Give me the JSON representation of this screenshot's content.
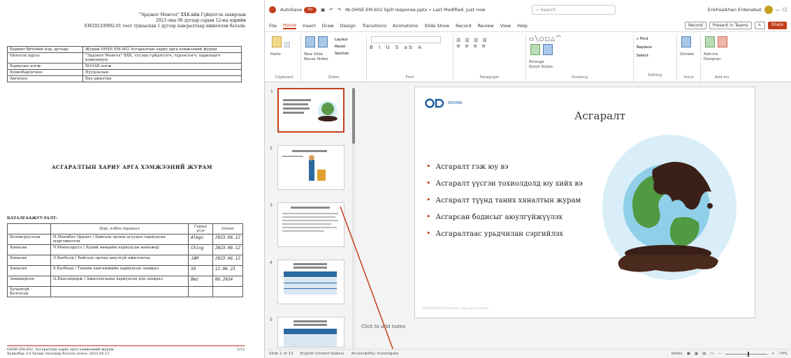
{
  "doc": {
    "header_lines": [
      "\"Эрдэнэт Монгол\" ХХК-ийн Гүйцэтгэх захирлын",
      "2023 оны 06 дугаар сарын 12-ны өдрийн",
      "EM2023/0902-01 тоот тушаалын 1 дүгээр хавсралтаар шинэчлэн баталв."
    ],
    "info_rows": [
      [
        "Баримт бичгийн нэр, дугаар:",
        "Журам OHSE.EM.602 Асгаралтын хариу арга хэмжээний журам"
      ],
      [
        "Үйлчлэх хүрээ:",
        "\"Эрдэнэт Монгол\" ХХК, туслан гүйцэтгэгч, түрээслэгч, харилцагч компаниуд"
      ],
      [
        "Хариуцах нэгж:",
        "БОЭАБ нэгж"
      ],
      [
        "Хувилбар/огноо:",
        "Нууцлалын"
      ],
      [
        "Ангилал:",
        "Бүх ажилтан"
      ]
    ],
    "title": "АСГАРАЛТЫН ХАРИУ АРГА ХЭМЖЭЭНИЙ ЖУРАМ",
    "bat_label": "БАТАЛГААЖУУЛАЛТ:",
    "sig_headers": [
      "",
      "Нэр, албан тушаал",
      "Гарын үсэг",
      "Огноо"
    ],
    "sig_rows": [
      [
        "Боловсруулсан",
        "Н.Мөнхбат-Эрдэнэ / Байгаль орчны асуудал хариуцсан мэргэжилтэн",
        "Alegs",
        "2023.06.12"
      ],
      [
        "Хянасан",
        "Ч.Мөнхсаруул / Хүний нөөцийн хариуцсан менежер",
        "Ching",
        "2023.06.12"
      ],
      [
        "Хянасан",
        "Э.Батболд / Байгаль орчны аюулгүй ажиллагаа",
        "JAM",
        "2023.06.12"
      ],
      [
        "Хянасан",
        "Х.Батбаяр / Техник хангамжийн хариуцсан захирал",
        "XX",
        "12.06.23"
      ],
      [
        "Зөвшөөрсөн",
        "Ц.Баасандорж / Ажиллагааны хариуцсан дэд захирал",
        "Bmz",
        "06.2024"
      ],
      [
        "Хүчингүй болгосон",
        "",
        "",
        ""
      ]
    ],
    "footer_left": "OHSE.EM.602. Асгаралтын хариу арга хэмжээний журам",
    "footer_left2": "Хувилбар 3.0 Хүчин төгөлдөр болсон огноо: 2023.06.12",
    "footer_page": "1/13"
  },
  "app": {
    "autosave_label": "AutoSave",
    "toggle_label": "On",
    "file_name": "IN.OHSE.EM.602 Spill response.pptx • Last Modified: Just now",
    "search_placeholder": "Search",
    "user_name": "Enkhsaikhan Erdenebat",
    "tabs": [
      "File",
      "Home",
      "Insert",
      "Draw",
      "Design",
      "Transitions",
      "Animations",
      "Slide Show",
      "Record",
      "Review",
      "View",
      "Help"
    ],
    "active_tab": "Home",
    "record_label": "Record",
    "present_label": "Present in Teams",
    "share_label": "Share"
  },
  "ribbon": {
    "groups": [
      "Clipboard",
      "Slides",
      "Font",
      "Paragraph",
      "Drawing",
      "Editing",
      "Voice",
      "Add-ins"
    ],
    "paste": "Paste",
    "new_slide": "New Slide",
    "reuse": "Reuse Slides",
    "layout": "Layout",
    "reset": "Reset",
    "section": "Section",
    "arrange": "Arrange",
    "quick_styles": "Quick Styles",
    "find": "Find",
    "replace": "Replace",
    "select": "Select",
    "dictate": "Dictate",
    "addins": "Add-ins",
    "designer": "Designer"
  },
  "thumbs": [
    "1",
    "2",
    "3",
    "4",
    "5"
  ],
  "slide": {
    "logo_text": "ERDENE",
    "title": "Асгаралт",
    "bullets": [
      "Асгаралт гэж юу вэ",
      "Асгаралт үүсгэн тохиолдолд юу хийх вэ",
      "Асгаралт түүнд таних хяналтын журам",
      "Асгарсан бодисыг аюулгүйжүүлэх",
      "Асгаралтаас урьдчилан сэргийлэх"
    ],
    "footer": "OHSE.EM.602 Асгаралтын хариу арга хэмжээ"
  },
  "notes_label": "Click to add notes",
  "status": {
    "slide_info": "Slide 1 of 13",
    "language": "English (United States)",
    "accessibility": "Accessibility: Investigate",
    "notes": "Notes",
    "zoom": "74%"
  },
  "colors": {
    "accent": "#c43e1c",
    "ocean": "#a8d4ea",
    "land": "#5a9a4a",
    "oil": "#3a2018"
  }
}
